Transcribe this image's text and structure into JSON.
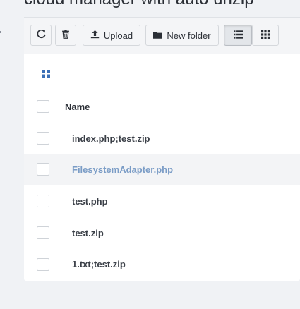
{
  "page": {
    "title": "cloud manager with auto unzip"
  },
  "toolbar": {
    "refresh_icon": "refresh-icon",
    "delete_icon": "trash-icon",
    "upload_label": "Upload",
    "new_folder_label": "New folder",
    "list_view_icon": "list-icon",
    "grid_view_icon": "grid-icon",
    "active_view": "list"
  },
  "file_list": {
    "header_name": "Name",
    "files": [
      {
        "name": "index.php;test.zip",
        "highlighted": false
      },
      {
        "name": "FilesystemAdapter.php",
        "highlighted": true
      },
      {
        "name": "test.php",
        "highlighted": false
      },
      {
        "name": "test.zip",
        "highlighted": false
      },
      {
        "name": "1.txt;test.zip",
        "highlighted": false
      }
    ]
  },
  "colors": {
    "background": "#f0f2f5",
    "panel": "#ffffff",
    "toolbar": "#f4f5f7",
    "link_text": "#7a9cc6",
    "grid_icon": "#3b6fb6"
  }
}
